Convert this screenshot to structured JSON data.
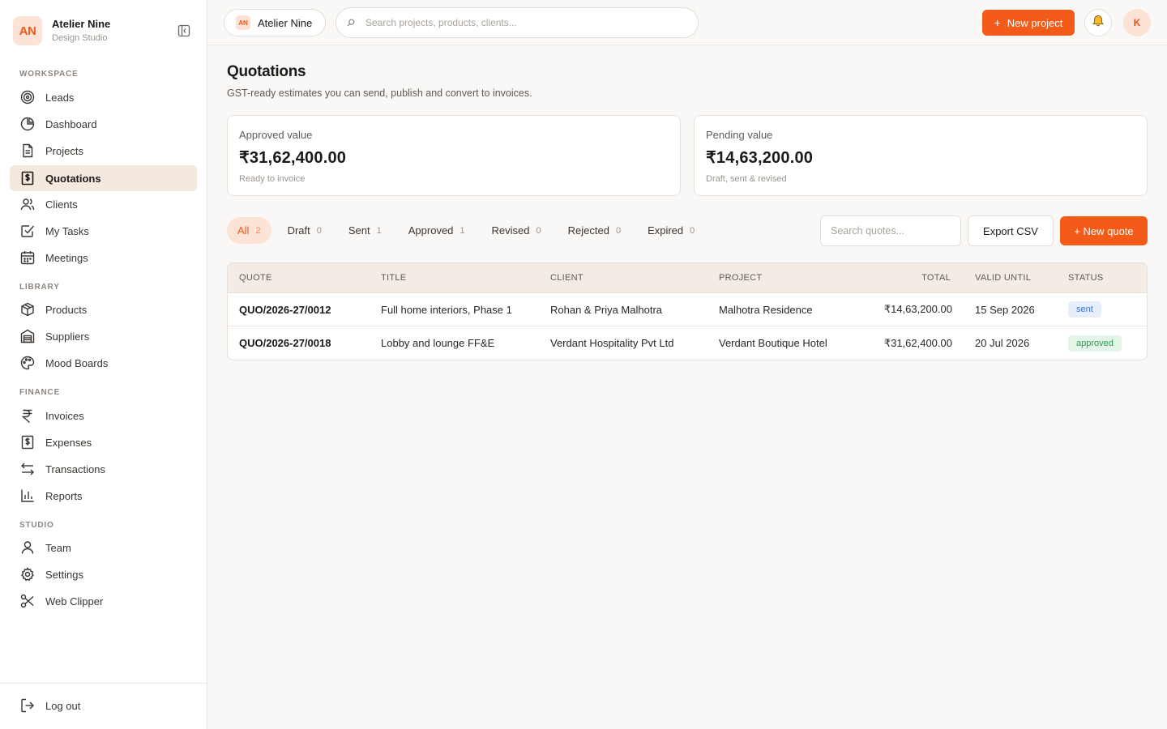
{
  "brand": {
    "initials": "AN",
    "name": "Atelier Nine",
    "subtitle": "Design Studio"
  },
  "sidebar": {
    "sections": [
      {
        "title": "WORKSPACE",
        "items": [
          {
            "label": "Leads",
            "icon": "target-icon"
          },
          {
            "label": "Dashboard",
            "icon": "pie-chart-icon"
          },
          {
            "label": "Projects",
            "icon": "file-text-icon"
          },
          {
            "label": "Quotations",
            "icon": "receipt-dollar-icon",
            "active": true
          },
          {
            "label": "Clients",
            "icon": "users-icon"
          },
          {
            "label": "My Tasks",
            "icon": "check-square-icon"
          },
          {
            "label": "Meetings",
            "icon": "calendar-icon"
          }
        ]
      },
      {
        "title": "LIBRARY",
        "items": [
          {
            "label": "Products",
            "icon": "box-icon"
          },
          {
            "label": "Suppliers",
            "icon": "warehouse-icon"
          },
          {
            "label": "Mood Boards",
            "icon": "palette-icon"
          }
        ]
      },
      {
        "title": "FINANCE",
        "items": [
          {
            "label": "Invoices",
            "icon": "rupee-icon"
          },
          {
            "label": "Expenses",
            "icon": "receipt-dollar-icon"
          },
          {
            "label": "Transactions",
            "icon": "arrows-left-right-icon"
          },
          {
            "label": "Reports",
            "icon": "bar-chart-icon"
          }
        ]
      },
      {
        "title": "STUDIO",
        "items": [
          {
            "label": "Team",
            "icon": "user-icon"
          },
          {
            "label": "Settings",
            "icon": "gear-icon"
          },
          {
            "label": "Web Clipper",
            "icon": "scissors-icon"
          }
        ]
      }
    ],
    "logout_label": "Log out"
  },
  "topbar": {
    "workspace_initials": "AN",
    "workspace_name": "Atelier Nine",
    "search_placeholder": "Search projects, products, clients...",
    "new_project_label": "New project",
    "user_initial": "K"
  },
  "page": {
    "title": "Quotations",
    "subtitle": "GST-ready estimates you can send, publish and convert to invoices."
  },
  "stats": [
    {
      "label": "Approved value",
      "value": "₹31,62,400.00",
      "note": "Ready to invoice"
    },
    {
      "label": "Pending value",
      "value": "₹14,63,200.00",
      "note": "Draft, sent & revised"
    }
  ],
  "filters": [
    {
      "label": "All",
      "count": "2",
      "active": true
    },
    {
      "label": "Draft",
      "count": "0"
    },
    {
      "label": "Sent",
      "count": "1"
    },
    {
      "label": "Approved",
      "count": "1"
    },
    {
      "label": "Revised",
      "count": "0"
    },
    {
      "label": "Rejected",
      "count": "0"
    },
    {
      "label": "Expired",
      "count": "0"
    }
  ],
  "toolbar": {
    "search_placeholder": "Search quotes...",
    "export_label": "Export CSV",
    "new_quote_label": "+ New quote"
  },
  "table": {
    "columns": [
      "QUOTE",
      "TITLE",
      "CLIENT",
      "PROJECT",
      "TOTAL",
      "VALID UNTIL",
      "STATUS"
    ],
    "rows": [
      {
        "quote": "QUO/2026-27/0012",
        "title": "Full home interiors, Phase 1",
        "client": "Rohan & Priya Malhotra",
        "project": "Malhotra Residence",
        "total": "₹14,63,200.00",
        "valid_until": "15 Sep 2026",
        "status": "sent"
      },
      {
        "quote": "QUO/2026-27/0018",
        "title": "Lobby and lounge FF&E",
        "client": "Verdant Hospitality Pvt Ltd",
        "project": "Verdant Boutique Hotel",
        "total": "₹31,62,400.00",
        "valid_until": "20 Jul 2026",
        "status": "approved"
      }
    ]
  },
  "colors": {
    "accent": "#f45a18",
    "accent_soft": "#fde3d6",
    "active_nav": "#f3e9df",
    "sent": "#3d6fd6",
    "approved": "#2f9a57"
  }
}
